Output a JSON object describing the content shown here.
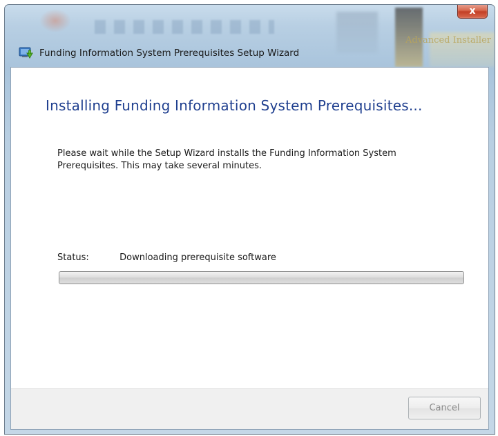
{
  "window": {
    "title": "Funding Information System Prerequisites Setup Wizard",
    "close_label": "x",
    "watermark": "Advanced Installer"
  },
  "icons": {
    "app": "installer-icon",
    "close": "close-icon"
  },
  "main": {
    "heading": "Installing Funding Information System Prerequisites...",
    "description_line1": "Please wait while the Setup Wizard installs the Funding Information System",
    "description_line2": "Prerequisites.  This may take several minutes.",
    "status_label": "Status:",
    "status_value": "Downloading prerequisite software",
    "progress_percent": 0
  },
  "footer": {
    "cancel_label": "Cancel",
    "cancel_enabled": false
  },
  "colors": {
    "heading": "#1f3f8f",
    "close_button": "#c33f26"
  }
}
